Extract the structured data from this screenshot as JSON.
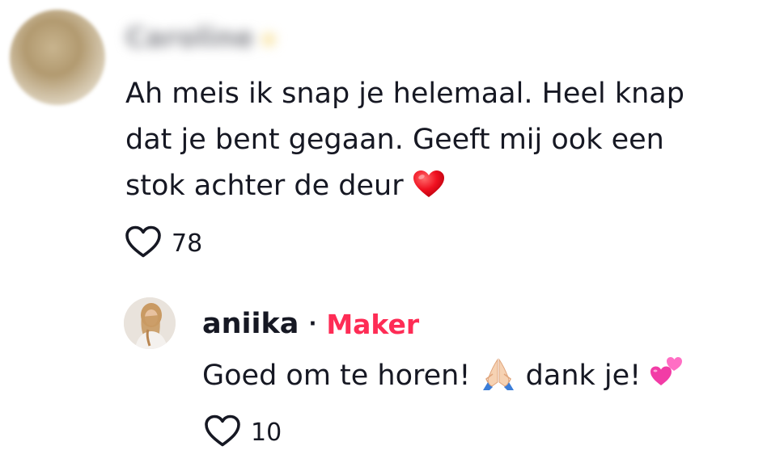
{
  "comment": {
    "username": "Caroline",
    "text_line1": "Ah meis ik snap je helemaal. Heel knap",
    "text_line2": "dat je bent gegaan. Geeft mij ook een",
    "text_line3": "stok achter de deur",
    "emoji": "red-heart",
    "likes": "78",
    "like_icon": "heart-outline-icon"
  },
  "reply": {
    "username": "aniika",
    "separator": "·",
    "badge": "Maker",
    "badge_color": "#fe2c55",
    "text_part1": "Goed om te horen!",
    "text_part2": "dank je!",
    "emoji_1": "folded-hands",
    "emoji_2": "two-hearts",
    "likes": "10",
    "like_icon": "heart-outline-icon"
  },
  "colors": {
    "text": "#161823",
    "accent": "#fe2c55",
    "background": "#ffffff"
  }
}
